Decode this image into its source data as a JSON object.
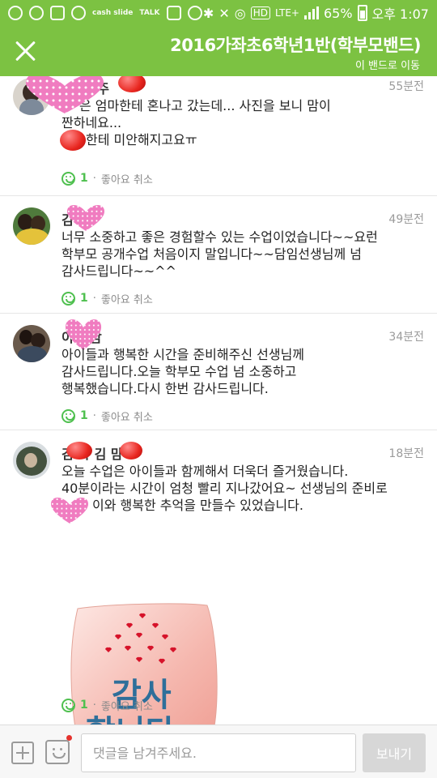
{
  "status_bar": {
    "battery_percent": "65%",
    "network": "LTE+",
    "time": "오후 1:07",
    "hd_label": "HD",
    "app_text": "cash slide",
    "talk_text": "TALK"
  },
  "header": {
    "title": "2016가좌초6학년1반(학부모밴드)",
    "move_label": "이 밴드로 이동"
  },
  "comments": [
    {
      "name": "맘 주",
      "time": "55분전",
      "lines": [
        "은 엄마한테 혼나고 갔는데... 사진을 보니 맘이",
        "짠하네요...",
        "한테 미안해지고요ㅠ"
      ],
      "like_count": "1",
      "like_action": "좋아요 취소"
    },
    {
      "name": "김 맘",
      "time": "49분전",
      "lines": [
        "너무 소중하고 좋은 경험할수 있는 수업이었습니다~~요런",
        "학부모 공개수업 처음이지 말입니다~~담임선생님께 넘",
        "감사드립니다~~^^"
      ],
      "like_count": "1",
      "like_action": "좋아요 취소"
    },
    {
      "name": "이 진맘",
      "time": "34분전",
      "lines": [
        "아이들과 행복한 시간을 준비해주신 선생님께",
        "감사드립니다.오늘 학부모 수업 넘 소중하고",
        "행복했습니다.다시 한번 감사드립니다."
      ],
      "like_count": "1",
      "like_action": "좋아요 취소"
    },
    {
      "name": "김 아 김 맘",
      "time": "18분전",
      "lines": [
        "오늘 수업은 아이들과 함께해서 더욱더 즐거웠습니다.",
        "40분이라는 시간이 엄청 빨리 지나갔어요~ 선생님의 준비로",
        "이와 행복한 추억을 만들수 있었습니다."
      ],
      "sticker_text": [
        "감사",
        "합니다"
      ],
      "like_count": "1",
      "like_action": "좋아요 취소"
    }
  ],
  "bottom_bar": {
    "input_placeholder": "댓글을 남겨주세요.",
    "send_label": "보내기"
  },
  "colors": {
    "brand": "#7cc242",
    "like": "#4fc04f",
    "notification_dot": "#e5322d"
  },
  "icons": [
    "close-icon",
    "plus-icon",
    "emoji-icon",
    "smile-icon",
    "wifi-icon",
    "battery-icon"
  ]
}
